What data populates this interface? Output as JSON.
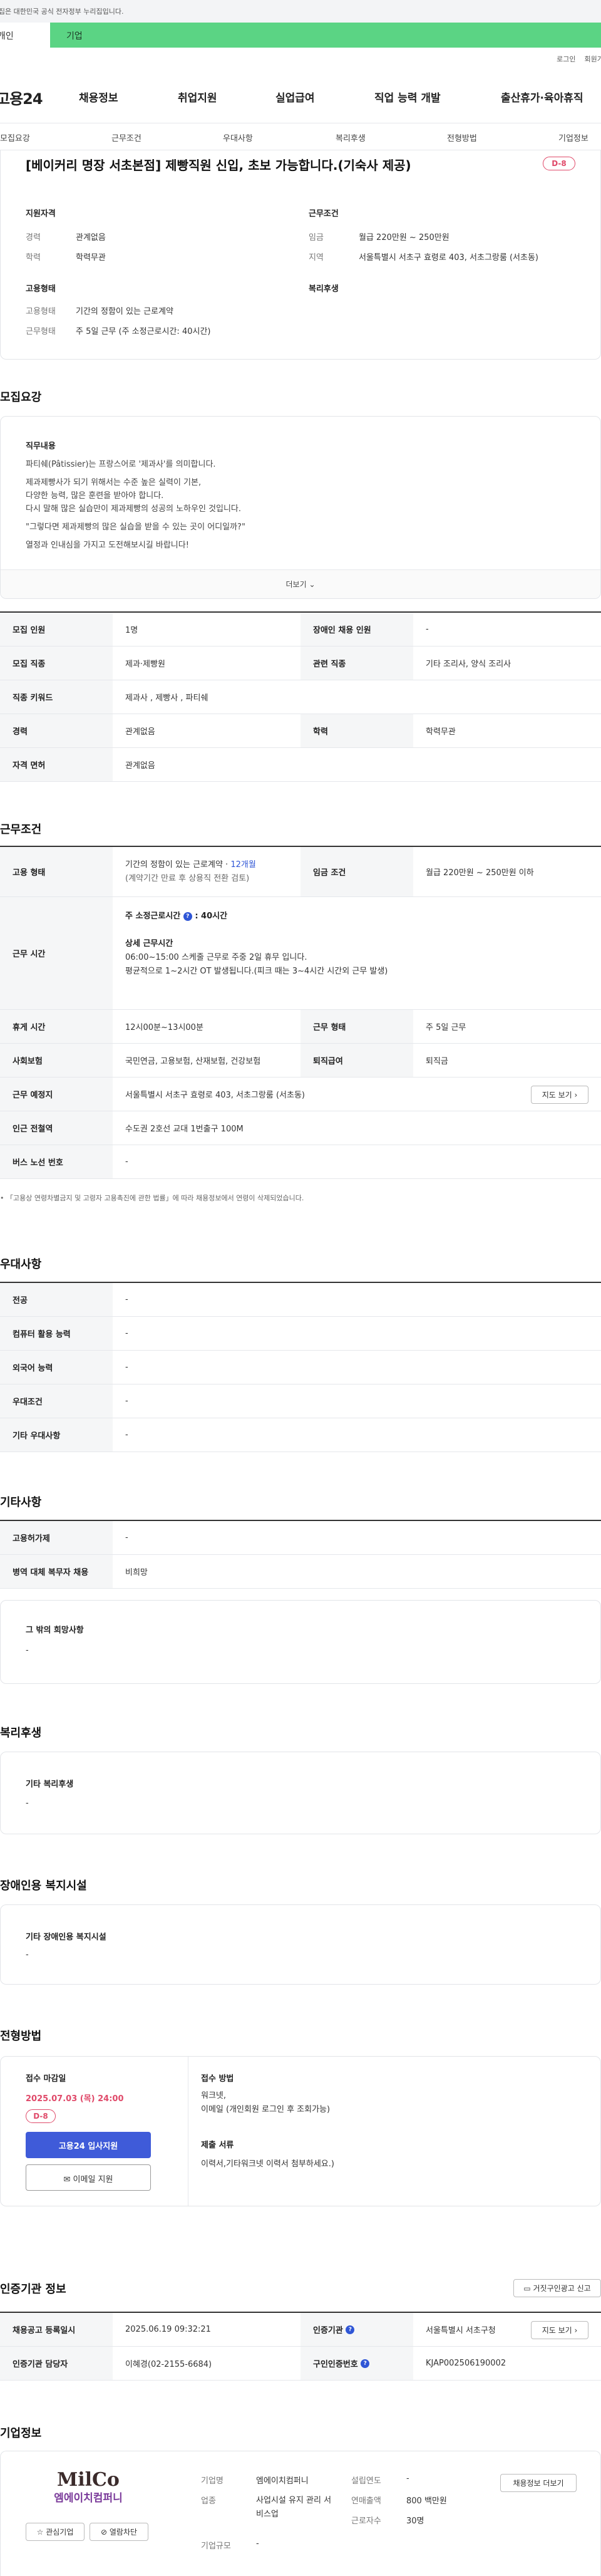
{
  "gov_banner": "이 누리집은 대한민국 공식 전자정부 누리집입니다.",
  "top_tabs": [
    "개인",
    "기업"
  ],
  "util_links": [
    "로그인",
    "회원가입"
  ],
  "logo": "고용24",
  "gnb": [
    "채용정보",
    "취업지원",
    "실업급여",
    "직업 능력 개발",
    "출산휴가·육아휴직"
  ],
  "snb": [
    "모집요강",
    "근무조건",
    "우대사항",
    "복리후생",
    "전형방법",
    "기업정보"
  ],
  "job": {
    "title": "[베이커리 명장 서초본점] 제빵직원 신입, 초보 가능합니다.(기숙사 제공)",
    "dday": "D-8",
    "qual_title": "지원자격",
    "work_title": "근무조건",
    "emp_title": "고용형태",
    "welfare_title": "복리후생",
    "career_label": "경력",
    "career": "관계없음",
    "edu_label": "학력",
    "edu": "학력무관",
    "wage_label": "임금",
    "wage": "월급 220만원 ~ 250만원",
    "area_label": "지역",
    "area": "서울특별시 서초구 효령로 403, 서초그랑룸 (서초동)",
    "emptype_label": "고용형태",
    "emptype": "기간의 정함이 있는 근로계약",
    "worktype_label": "근무형태",
    "worktype": "주 5일 근무 (주 소정근로시간: 40시간)"
  },
  "recruit": {
    "title": "모집요강",
    "duty_title": "직무내용",
    "desc": [
      "파티쉐(Pâtissier)는 프랑스어로 '제과사'를 의미합니다.",
      "",
      "제과제빵사가 되기 위해서는 수준 높은 실력이 기본,",
      "다양한 능력, 많은 훈련을 받아야 합니다.",
      "다시 말해 많은 실습만이 제과제빵의 성공의 노하우인 것입니다.",
      "",
      "\"그렇다면 제과제빵의 많은 실습을 받을 수 있는 곳이 어디일까?\"",
      "",
      "열정과 인내심을 가지고 도전해보시길 바랍니다!"
    ],
    "more": "더보기",
    "rows": [
      {
        "l": "모집 인원",
        "v": "1명",
        "l2": "장애인 채용 인원",
        "v2": "-"
      },
      {
        "l": "모집 직종",
        "v": "제과·제빵원",
        "l2": "관련 직종",
        "v2": "기타 조리사, 양식 조리사"
      },
      {
        "l": "직종 키워드",
        "v": "제과사 , 제빵사 , 파티쉐",
        "l2": "",
        "v2": ""
      },
      {
        "l": "경력",
        "v": "관계없음",
        "l2": "학력",
        "v2": "학력무관"
      },
      {
        "l": "자격 면허",
        "v": "관계없음",
        "l2": "",
        "v2": ""
      }
    ]
  },
  "work": {
    "title": "근무조건",
    "emp_label": "고용 형태",
    "emp_v1": "기간의 정함이 있는 근로계약 · ",
    "emp_months": "12개월",
    "emp_v2": "(계약기간 만료 후 상용직 전환 검토)",
    "wage_label": "임금 조건",
    "wage": "월급 220만원 ~ 250만원 이하",
    "hours_label": "근무 시간",
    "hours_std": "주 소정근로시간",
    "hours_std_v": ": 40시간",
    "hours_detail_title": "상세 근무시간",
    "hours_detail": [
      "06:00~15:00 스케줄 근무로 주중 2일 휴무 입니다.",
      "평균적으로 1~2시간 OT 발생됩니다.(피크 때는 3~4시간 시간외 근무 발생)"
    ],
    "break_label": "휴게 시간",
    "break": "12시00분~13시00분",
    "form_label": "근무 형태",
    "form": "주 5일 근무",
    "ins_label": "사회보험",
    "ins": "국민연금, 고용보험, 산재보험, 건강보험",
    "retire_label": "퇴직급여",
    "retire": "퇴직금",
    "place_label": "근무 예정지",
    "place": "서울특별시 서초구 효령로 403, 서초그랑룸 (서초동)",
    "map_btn": "지도 보기",
    "subway_label": "인근 전철역",
    "subway": "수도권 2호선 교대 1번출구 100M",
    "bus_label": "버스 노선 번호",
    "bus": "-",
    "note": "「고용상 연령차별금지 및 고령자 고용촉진에 관한 법률」에 따라 채용정보에서 연령이 삭제되었습니다."
  },
  "pref": {
    "title": "우대사항",
    "rows": [
      {
        "l": "전공",
        "v": "-"
      },
      {
        "l": "컴퓨터 활용 능력",
        "v": "-"
      },
      {
        "l": "외국어 능력",
        "v": "-"
      },
      {
        "l": "우대조건",
        "v": "-"
      },
      {
        "l": "기타 우대사항",
        "v": "-"
      }
    ]
  },
  "etc": {
    "title": "기타사항",
    "rows": [
      {
        "l": "고용허가제",
        "v": "-"
      },
      {
        "l": "병역 대체 복무자 채용",
        "v": "비희망"
      }
    ],
    "wish_title": "그 밖의 희망사항",
    "wish": "-"
  },
  "welfare": {
    "title": "복리후생",
    "box_title": "기타 복리후생",
    "box_v": "-"
  },
  "disab": {
    "title": "장애인용 복지시설",
    "box_title": "기타 장애인용 복지시설",
    "box_v": "-"
  },
  "process": {
    "title": "전형방법",
    "deadline_label": "접수 마감일",
    "deadline": "2025.07.03 (목) 24:00",
    "dday": "D-8",
    "apply_btn": "고용24 입사지원",
    "email_btn": "이메일 지원",
    "method_title": "접수 방법",
    "method": [
      "워크넷,",
      "이메일 (개인회원 로그인 후 조회가능)"
    ],
    "docs_title": "제출 서류",
    "docs": "이력서,기타워크넷 이력서 첨부하세요.)"
  },
  "cert": {
    "title": "인증기관 정보",
    "report_btn": "거짓구인광고 신고",
    "rows": [
      {
        "l": "채용공고 등록일시",
        "v": "2025.06.19 09:32:21",
        "l2": "인증기관",
        "v2": "서울특별시 서초구청",
        "btn": "지도 보기"
      },
      {
        "l": "인증기관 담당자",
        "v": "이혜경(02-2155-6684)",
        "l2": "구인인증번호",
        "v2": "KJAP002506190002",
        "btn": ""
      }
    ]
  },
  "company": {
    "title": "기업정보",
    "logo_top": "MilCo",
    "logo_bottom": "엠에이치컴퍼니",
    "fav_btn": "관심기업",
    "block_btn": "열람차단",
    "jobs_btn": "채용정보 더보기",
    "name_label": "기업명",
    "name": "엠에이치컴퍼니",
    "biz_label": "업종",
    "biz": "사업시설 유지 관리 서비스업",
    "size_label": "기업규모",
    "size": "-",
    "found_label": "설립연도",
    "found": "-",
    "sales_label": "연매출액",
    "sales": "800 백만원",
    "emp_label": "근로자수",
    "emp": "30명"
  }
}
